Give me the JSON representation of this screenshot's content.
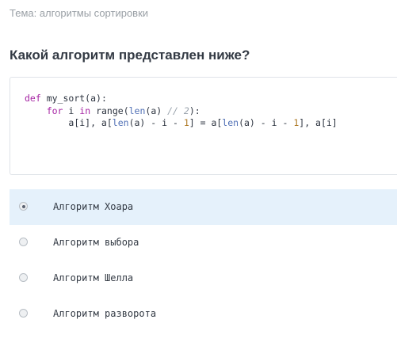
{
  "topic": "Тема: алгоритмы сортировки",
  "question": "Какой алгоритм представлен ниже?",
  "code": {
    "line1": {
      "def": "def",
      "rest": " my_sort(a):"
    },
    "line2": {
      "for": "for",
      "i": " i ",
      "in": "in",
      "range": "range",
      "open": "(",
      "len": "len",
      "args": "(a) ",
      "comment": "// 2",
      "close": "):"
    },
    "line3": {
      "p1": "a[i], a[",
      "len1": "len",
      "p2": "(a) - i - ",
      "n1": "1",
      "p3": "] = a[",
      "len2": "len",
      "p4": "(a) - i - ",
      "n2": "1",
      "p5": "], a[i]"
    }
  },
  "options": [
    {
      "label": "Алгоритм Хоара",
      "selected": true
    },
    {
      "label": "Алгоритм выбора",
      "selected": false
    },
    {
      "label": "Алгоритм Шелла",
      "selected": false
    },
    {
      "label": "Алгоритм разворота",
      "selected": false
    }
  ],
  "colors": {
    "selected_bg": "#e5f1fb",
    "keyword": "#a626a4",
    "builtin": "#4f6fb5",
    "number": "#b07d2b"
  }
}
